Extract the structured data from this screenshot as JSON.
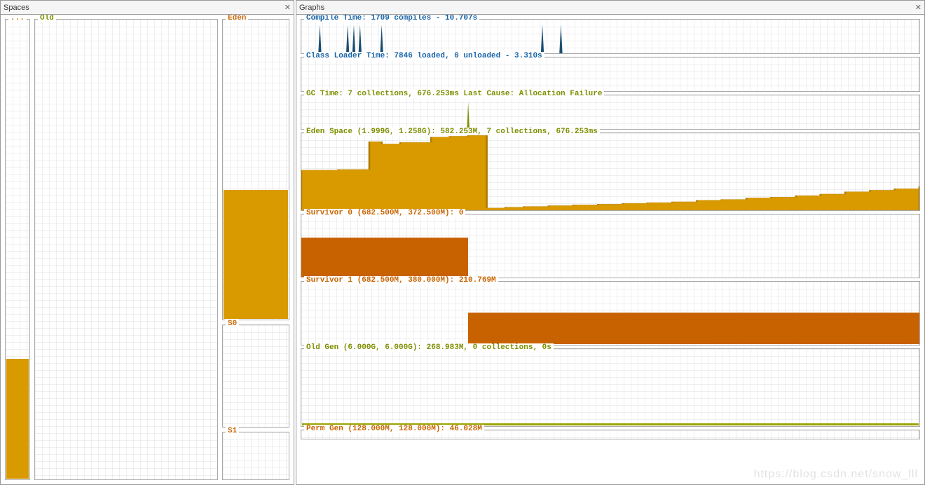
{
  "panels": {
    "spaces_title": "Spaces",
    "graphs_title": "Graphs"
  },
  "spaces": {
    "perm_label": "...",
    "old_label": "Old",
    "eden_label": "Eden",
    "s0_label": "S0",
    "s1_label": "S1",
    "fills": {
      "perm_pct": 26,
      "old_pct": 0,
      "eden_pct": 43,
      "s0_pct": 0,
      "s1_pct": 0
    }
  },
  "graphs": {
    "compile": {
      "label": "Compile Time: 1709 compiles - 10.707s",
      "spikes_x_pct": [
        3,
        7.5,
        8.5,
        9.5,
        13,
        39,
        42
      ]
    },
    "classloader": {
      "label": "Class Loader Time: 7846 loaded, 0 unloaded - 3.310s"
    },
    "gc": {
      "label": "GC Time: 7 collections, 676.253ms Last Cause: Allocation Failure",
      "spike_x_pct": 27
    },
    "eden": {
      "label": "Eden Space (1.999G, 1.258G): 582.253M, 7 collections, 676.253ms"
    },
    "s0": {
      "label": "Survivor 0 (682.500M, 372.500M): 0",
      "fill_left_pct": 0,
      "fill_right_pct": 27,
      "fill_height_pct": 62
    },
    "s1": {
      "label": "Survivor 1 (682.500M, 380.000M): 210.769M",
      "fill_left_pct": 27,
      "fill_right_pct": 100,
      "fill_height_pct": 50
    },
    "old": {
      "label": "Old Gen (6.000G, 6.000G): 268.983M, 0 collections, 0s",
      "baseline_height_px": 3
    },
    "perm": {
      "label": "Perm Gen (128.000M, 128.000M): 46.028M"
    }
  },
  "chart_data": {
    "type": "area",
    "title": "Eden Space (1.999G, 1.258G): 582.253M, 7 collections, 676.253ms",
    "xlabel": "",
    "ylabel": "",
    "ylim": [
      0,
      100
    ],
    "x_pct": [
      0,
      3,
      6,
      9,
      11,
      13,
      16,
      18,
      21,
      24,
      27,
      30,
      33,
      36,
      40,
      44,
      48,
      52,
      56,
      60,
      64,
      68,
      72,
      76,
      80,
      84,
      88,
      92,
      96,
      100
    ],
    "y_pct": [
      52,
      52,
      53,
      53,
      89,
      86,
      88,
      88,
      95,
      96,
      97,
      3,
      4,
      5,
      6,
      7,
      8,
      9,
      10,
      11,
      13,
      14,
      16,
      17,
      19,
      21,
      24,
      26,
      28,
      31
    ]
  },
  "watermark": "https://blog.csdn.net/snow_lll"
}
